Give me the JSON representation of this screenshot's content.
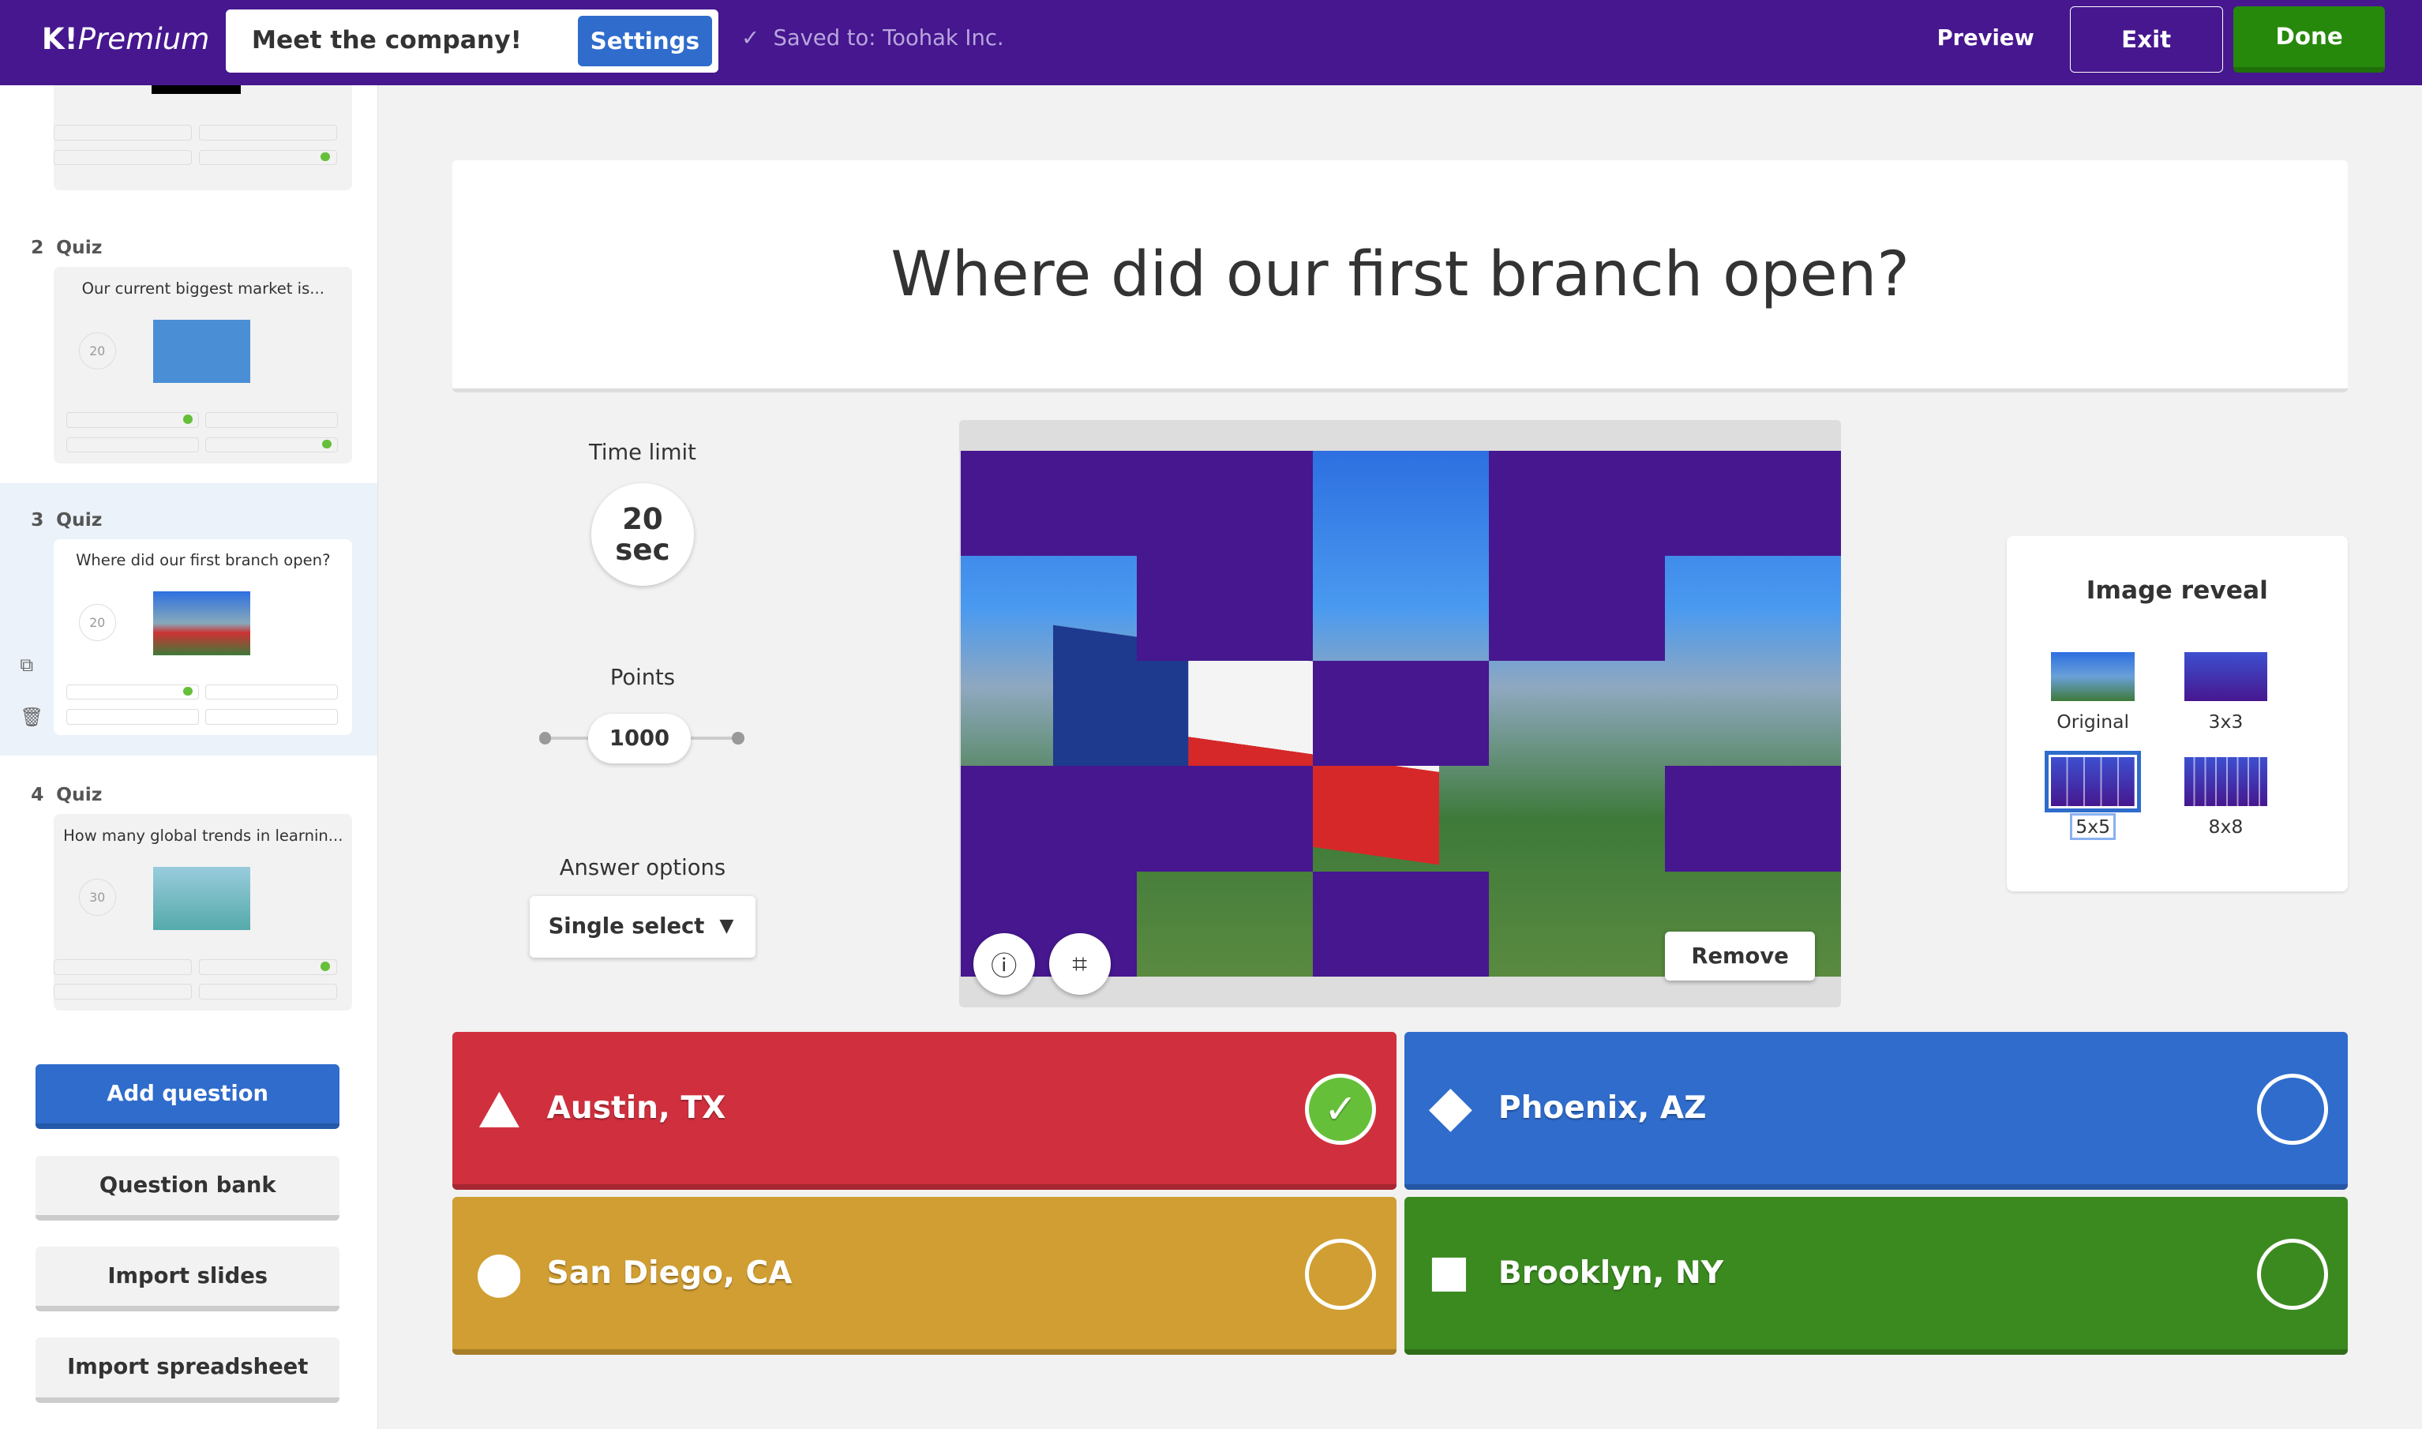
{
  "header": {
    "logo": "K!Premium",
    "logo_k": "K!",
    "logo_word": "Premium",
    "title": "Meet the company!",
    "settings": "Settings",
    "saved": "Saved to: Toohak Inc.",
    "preview": "Preview",
    "exit": "Exit",
    "done": "Done"
  },
  "sidebar": {
    "slides": [
      {
        "num": "2",
        "type": "Quiz",
        "question": "Our current biggest market is...",
        "time": "20"
      },
      {
        "num": "3",
        "type": "Quiz",
        "question": "Where did our first branch open?",
        "time": "20"
      },
      {
        "num": "4",
        "type": "Quiz",
        "question": "How many global trends in learnin...",
        "time": "30"
      }
    ],
    "buttons": {
      "add": "Add question",
      "bank": "Question bank",
      "slides": "Import slides",
      "sheet": "Import spreadsheet"
    }
  },
  "question": "Where did our first branch open?",
  "settings": {
    "time_label": "Time limit",
    "time_value": "20",
    "time_unit": "sec",
    "points_label": "Points",
    "points_value": "1000",
    "answer_label": "Answer options",
    "answer_value": "Single select"
  },
  "media": {
    "remove": "Remove"
  },
  "reveal": {
    "title": "Image reveal",
    "options": [
      "Original",
      "3x3",
      "5x5",
      "8x8"
    ],
    "selected": "5x5"
  },
  "answers": [
    {
      "text": "Austin, TX",
      "shape": "triangle",
      "color": "#d0303e",
      "correct": true
    },
    {
      "text": "Phoenix, AZ",
      "shape": "diamond",
      "color": "#2f6ccc",
      "correct": false
    },
    {
      "text": "San Diego, CA",
      "shape": "circle",
      "color": "#d09e32",
      "correct": false
    },
    {
      "text": "Brooklyn, NY",
      "shape": "square",
      "color": "#3b8a20",
      "correct": false
    }
  ]
}
